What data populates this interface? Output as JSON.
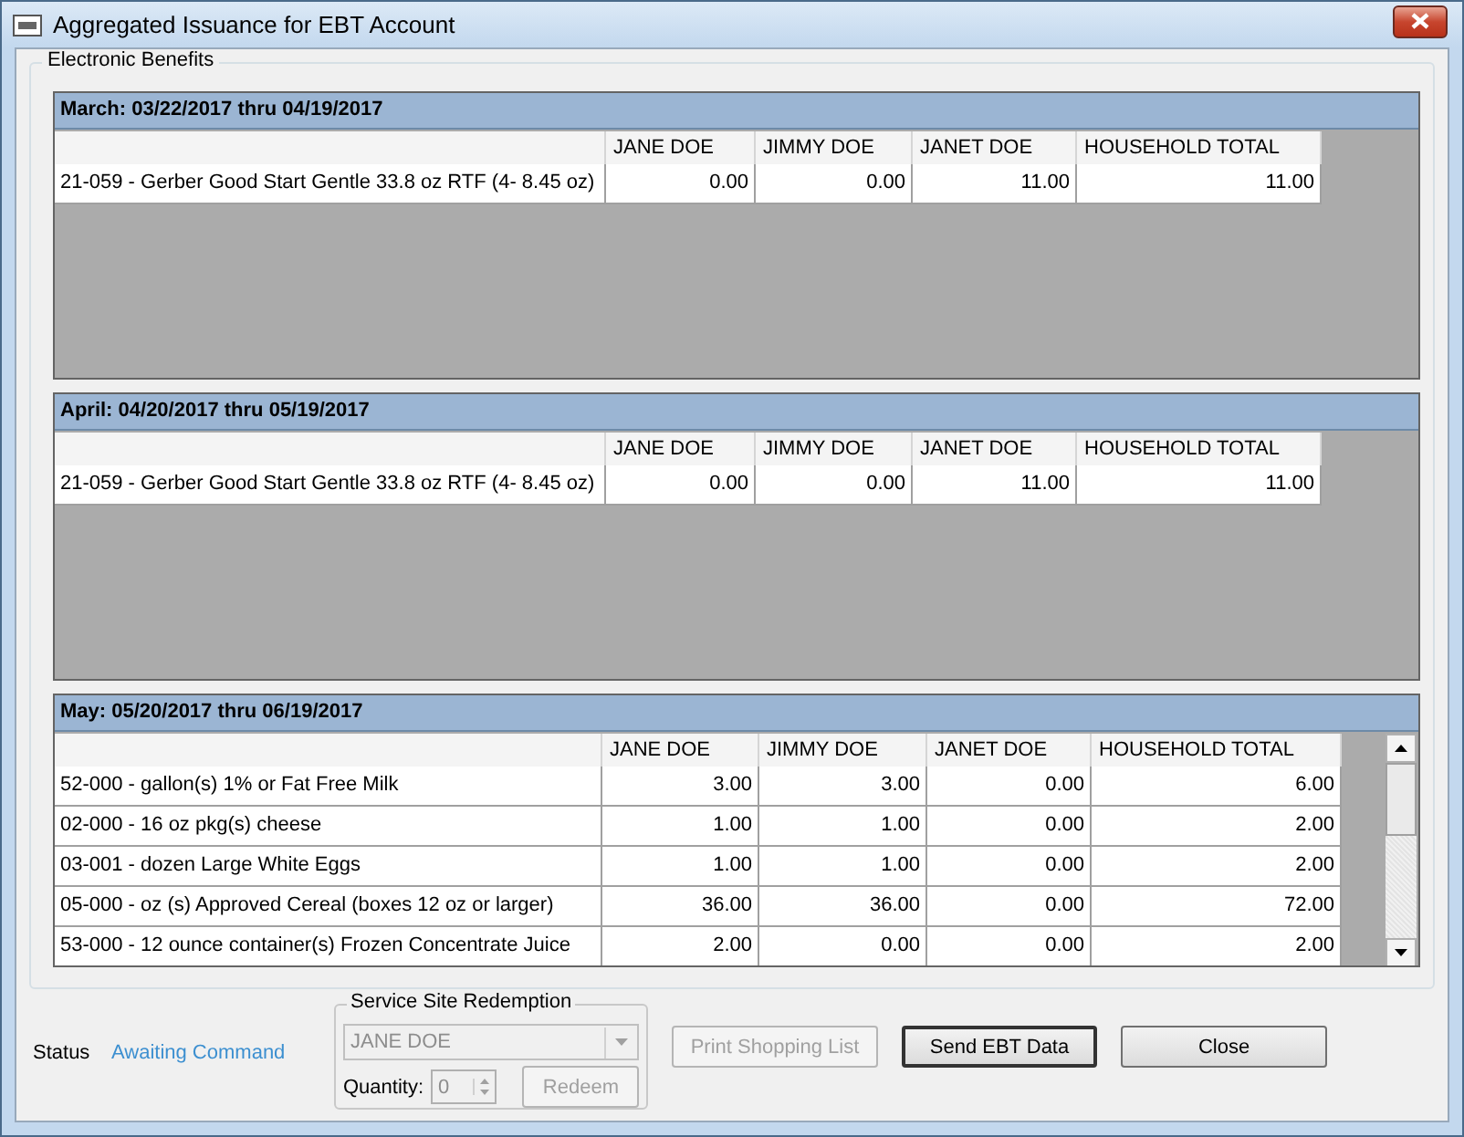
{
  "window": {
    "title": "Aggregated Issuance for EBT Account"
  },
  "group_title": "Electronic Benefits",
  "periods": [
    {
      "kind": "static",
      "title": "March: 03/22/2017 thru 04/19/2017",
      "columns": [
        "JANE DOE",
        "JIMMY DOE",
        "JANET DOE",
        "HOUSEHOLD TOTAL"
      ],
      "rows": [
        {
          "item": "21-059 - Gerber Good Start Gentle 33.8 oz RTF (4- 8.45 oz)",
          "values": [
            "0.00",
            "0.00",
            "11.00",
            "11.00"
          ]
        }
      ]
    },
    {
      "kind": "static",
      "title": "April: 04/20/2017 thru 05/19/2017",
      "columns": [
        "JANE DOE",
        "JIMMY DOE",
        "JANET DOE",
        "HOUSEHOLD TOTAL"
      ],
      "rows": [
        {
          "item": "21-059 - Gerber Good Start Gentle 33.8 oz RTF (4- 8.45 oz)",
          "values": [
            "0.00",
            "0.00",
            "11.00",
            "11.00"
          ]
        }
      ]
    },
    {
      "kind": "scrolling",
      "title": "May: 05/20/2017 thru 06/19/2017",
      "columns": [
        "JANE DOE",
        "JIMMY DOE",
        "JANET DOE",
        "HOUSEHOLD TOTAL"
      ],
      "rows": [
        {
          "item": "52-000 - gallon(s) 1% or Fat Free Milk",
          "values": [
            "3.00",
            "3.00",
            "0.00",
            "6.00"
          ]
        },
        {
          "item": "02-000 - 16 oz pkg(s) cheese",
          "values": [
            "1.00",
            "1.00",
            "0.00",
            "2.00"
          ]
        },
        {
          "item": "03-001 - dozen Large White Eggs",
          "values": [
            "1.00",
            "1.00",
            "0.00",
            "2.00"
          ]
        },
        {
          "item": "05-000 - oz (s) Approved Cereal (boxes 12 oz or larger)",
          "values": [
            "36.00",
            "36.00",
            "0.00",
            "72.00"
          ]
        },
        {
          "item": "53-000 - 12 ounce container(s) Frozen Concentrate Juice",
          "values": [
            "2.00",
            "0.00",
            "0.00",
            "2.00"
          ]
        }
      ]
    }
  ],
  "status": {
    "label": "Status",
    "value": "Awaiting Command"
  },
  "redemption": {
    "title": "Service Site Redemption",
    "member": "JANE DOE",
    "quantity_label": "Quantity:",
    "quantity": "0",
    "disabled": true,
    "button": "Redeem"
  },
  "buttons": [
    {
      "label": "Print Shopping List",
      "disabled": true,
      "default": false
    },
    {
      "label": "Send EBT Data",
      "disabled": false,
      "default": true
    },
    {
      "label": "Close",
      "disabled": false,
      "default": false
    }
  ]
}
